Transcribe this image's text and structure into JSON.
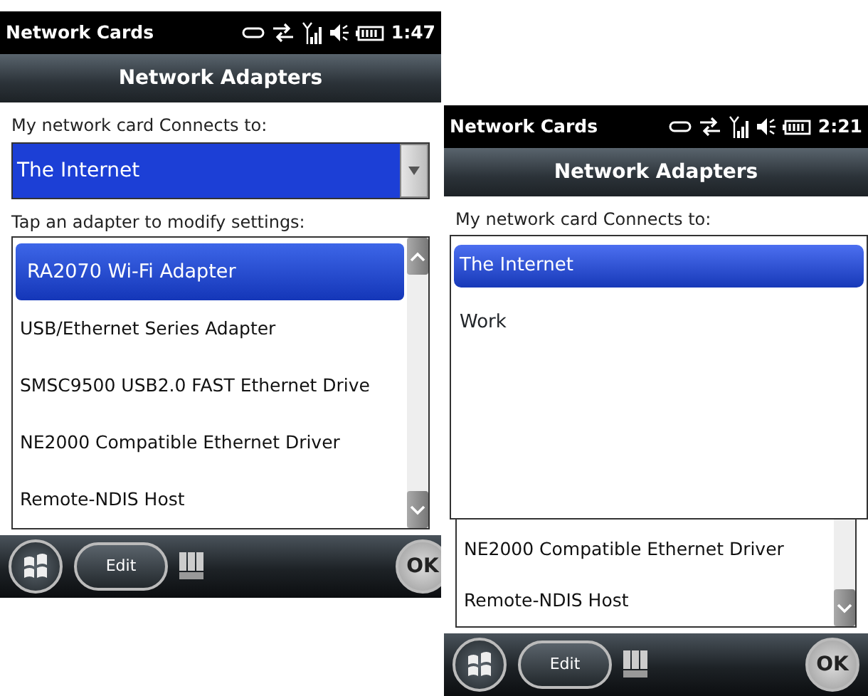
{
  "screens": [
    {
      "status_bar": {
        "app_title": "Network Cards",
        "time": "1:47"
      },
      "header": "Network Adapters",
      "connects_label": "My network card Connects to:",
      "connects_dropdown": {
        "value": "The Internet",
        "open": false
      },
      "adapters_label": "Tap an adapter to modify settings:",
      "adapters": [
        {
          "name": "RA2070 Wi-Fi Adapter",
          "selected": true
        },
        {
          "name": "USB/Ethernet Series Adapter",
          "selected": false
        },
        {
          "name": "SMSC9500 USB2.0 FAST Ethernet Drive",
          "selected": false
        },
        {
          "name": "NE2000 Compatible Ethernet Driver",
          "selected": false
        },
        {
          "name": "Remote-NDIS Host",
          "selected": false
        }
      ],
      "softkeys": {
        "edit": "Edit",
        "ok": "OK"
      }
    },
    {
      "status_bar": {
        "app_title": "Network Cards",
        "time": "2:21"
      },
      "header": "Network Adapters",
      "connects_label": "My network card Connects to:",
      "connects_dropdown": {
        "open": true,
        "options": [
          {
            "label": "The Internet",
            "selected": true
          },
          {
            "label": "Work",
            "selected": false
          }
        ]
      },
      "adapters": [
        {
          "name": "NE2000 Compatible Ethernet Driver",
          "selected": false
        },
        {
          "name": "Remote-NDIS Host",
          "selected": false
        }
      ],
      "softkeys": {
        "edit": "Edit",
        "ok": "OK"
      }
    }
  ]
}
